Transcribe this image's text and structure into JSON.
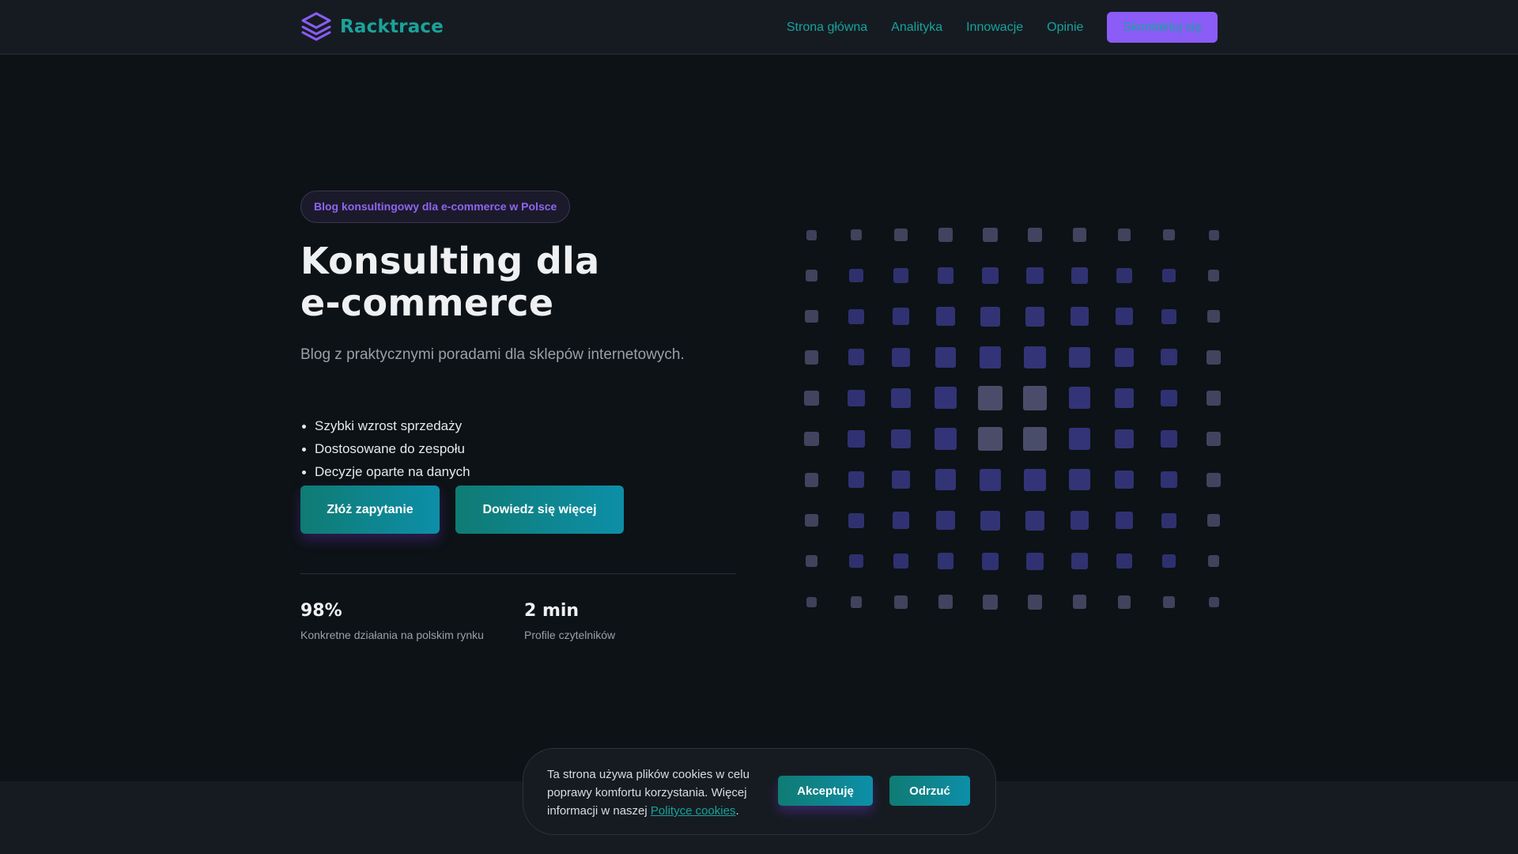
{
  "header": {
    "brand": "Racktrace",
    "nav": [
      {
        "label": "Strona główna"
      },
      {
        "label": "Analityka"
      },
      {
        "label": "Innowacje"
      },
      {
        "label": "Opinie"
      }
    ],
    "cta_label": "Skontaktuj się"
  },
  "hero": {
    "badge": "Blog konsultingowy dla e-commerce w Polsce",
    "title_line1": "Konsulting dla",
    "title_line2": "e-commerce",
    "subtitle": "Blog z praktycznymi poradami dla sklepów internetowych.",
    "features": [
      "Szybki wzrost sprzedaży",
      "Dostosowane do zespołu",
      "Decyzje oparte na danych"
    ],
    "primary_button": "Złóż zapytanie",
    "secondary_button": "Dowiedz się więcej",
    "stats": [
      {
        "value": "98%",
        "label": "Konkretne działania na polskim rynku"
      },
      {
        "value": "2 min",
        "label": "Profile czytelników"
      }
    ]
  },
  "cookie": {
    "text_before": "Ta strona używa plików cookies w celu poprawy komfortu korzystania. Więcej informacji w naszej ",
    "link_text": "Polityce cookies",
    "text_after": ".",
    "accept_label": "Akceptuję",
    "reject_label": "Odrzuć"
  },
  "colors": {
    "background": "#0d1216",
    "header": "#161b22",
    "accent_purple": "#8b5cf6",
    "accent_teal": "#17a39b",
    "grid_indigo": "#35367d",
    "grid_gray": "#4a4d6a"
  },
  "icons": {
    "logo": "layers-icon"
  }
}
